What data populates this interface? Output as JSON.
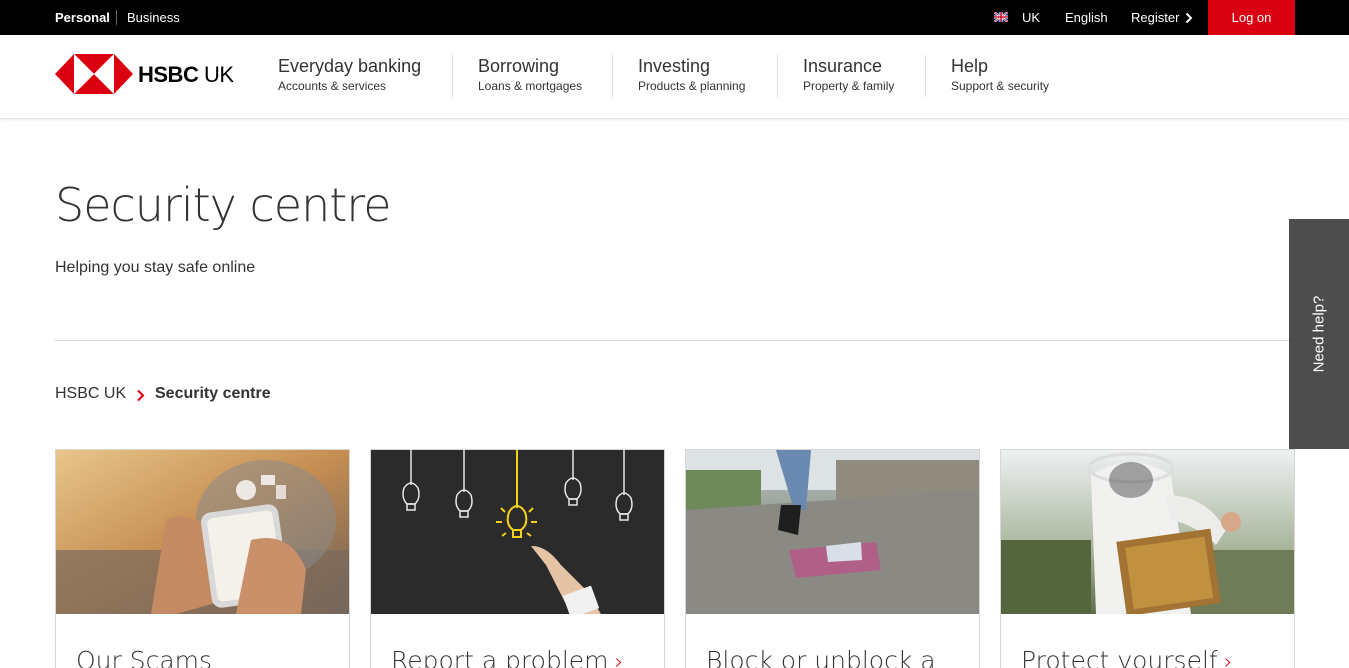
{
  "topbar": {
    "personal": "Personal",
    "business": "Business",
    "country": "UK",
    "language": "English",
    "register": "Register",
    "logon": "Log on"
  },
  "brand": {
    "name_bold": "HSBC",
    "name_regular": " UK",
    "brand_red": "#db0011"
  },
  "nav": [
    {
      "title": "Everyday banking",
      "sub": "Accounts & services"
    },
    {
      "title": "Borrowing",
      "sub": "Loans & mortgages"
    },
    {
      "title": "Investing",
      "sub": "Products & planning"
    },
    {
      "title": "Insurance",
      "sub": "Property & family"
    },
    {
      "title": "Help",
      "sub": "Support & security"
    }
  ],
  "page": {
    "title": "Security centre",
    "subtitle": "Helping you stay safe online"
  },
  "breadcrumb": {
    "home": "HSBC UK",
    "current": "Security centre"
  },
  "needhelp": "Need help?",
  "cards": [
    {
      "title": "Our Scams",
      "image": "phone-notifications-image"
    },
    {
      "title": "Report a problem",
      "image": "lightbulb-chalkboard-image"
    },
    {
      "title": "Block or unblock a",
      "image": "dropped-wallet-image"
    },
    {
      "title": "Protect yourself",
      "image": "beekeeper-image"
    }
  ]
}
